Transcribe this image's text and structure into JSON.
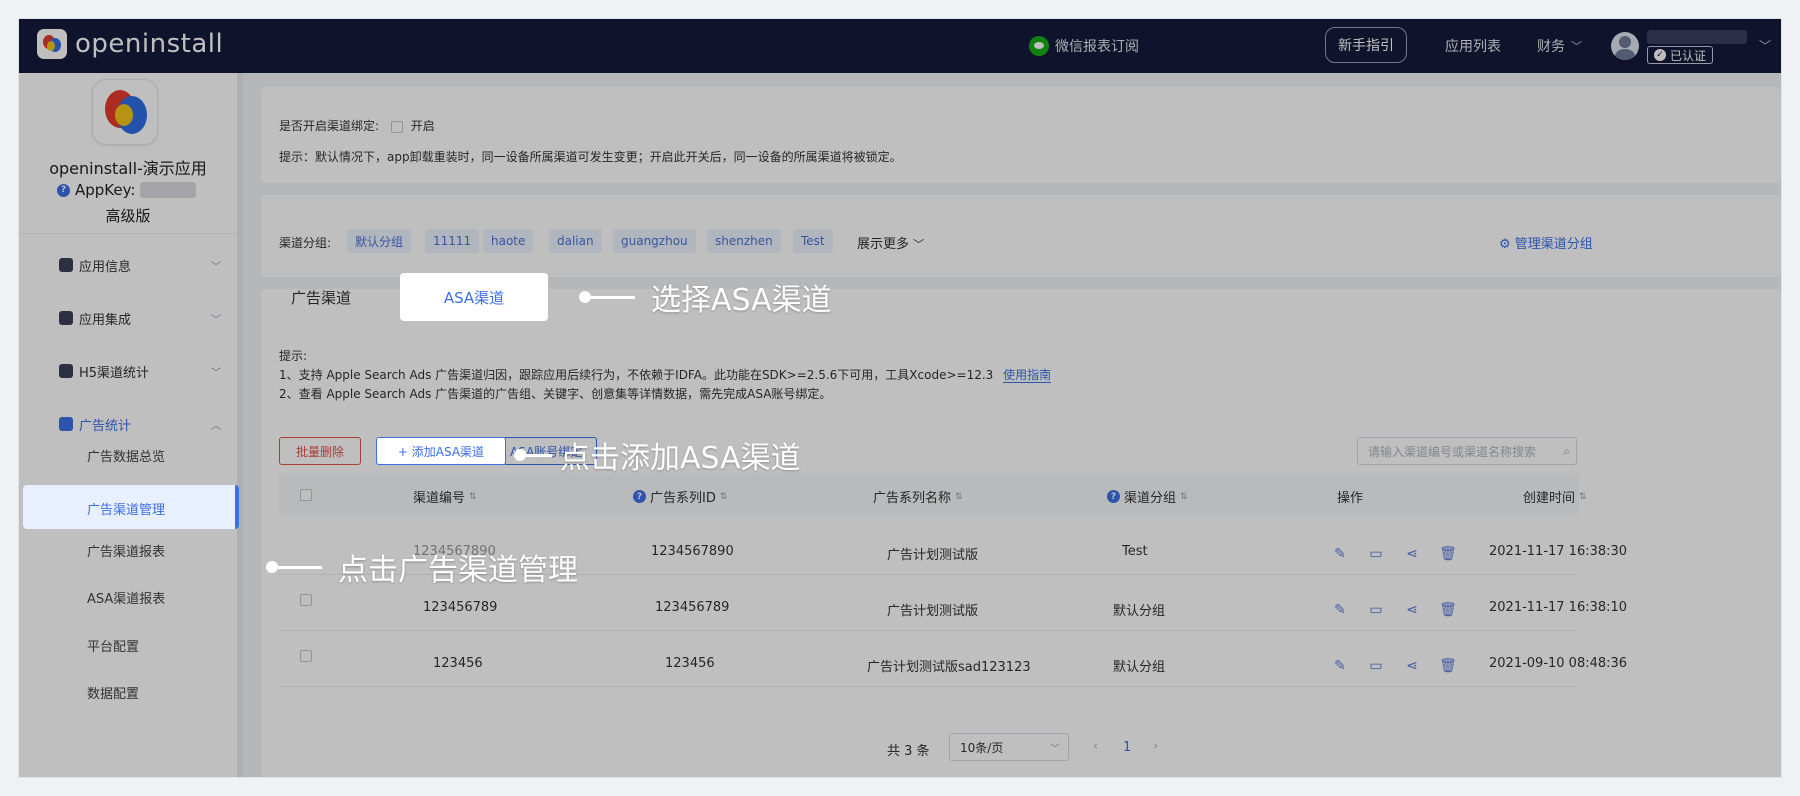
{
  "header": {
    "logo_text": "openinstall",
    "wechat_label": "微信报表订阅",
    "guide_label": "新手指引",
    "app_list_label": "应用列表",
    "finance_label": "财务",
    "verified_label": "已认证"
  },
  "sidebar": {
    "app_name": "openinstall-演示应用",
    "appkey_label": "AppKey:",
    "edition": "高级版",
    "menus": [
      {
        "label": "应用信息"
      },
      {
        "label": "应用集成"
      },
      {
        "label": "H5渠道统计"
      },
      {
        "label": "广告统计"
      }
    ],
    "submenus": [
      {
        "label": "广告数据总览"
      },
      {
        "label": "广告渠道管理"
      },
      {
        "label": "广告渠道报表"
      },
      {
        "label": "ASA渠道报表"
      },
      {
        "label": "平台配置"
      },
      {
        "label": "数据配置"
      }
    ]
  },
  "binding": {
    "label": "是否开启渠道绑定:",
    "option": "开启",
    "hint": "提示：默认情况下，app卸载重装时，同一设备所属渠道可发生变更；开启此开关后，同一设备的所属渠道将被锁定。"
  },
  "groups": {
    "label": "渠道分组:",
    "tags": [
      "默认分组",
      "11111",
      "haote",
      "dalian",
      "guangzhou",
      "shenzhen",
      "Test"
    ],
    "more_label": "展示更多",
    "manage_label": "管理渠道分组"
  },
  "tabs": [
    {
      "label": "广告渠道"
    },
    {
      "label": "ASA渠道"
    }
  ],
  "tips": {
    "title": "提示:",
    "line1": "1、支持 Apple Search Ads 广告渠道归因，跟踪应用后续行为，不依赖于IDFA。此功能在SDK>=2.5.6下可用，工具Xcode>=12.3",
    "line1_link": "使用指南",
    "line2": "2、查看 Apple Search Ads 广告渠道的广告组、关键字、创意集等详情数据，需先完成ASA账号绑定。"
  },
  "toolbar": {
    "batch_delete": "批量删除",
    "add_asa": "+ 添加ASA渠道",
    "bind_asa": "ASA账号绑定",
    "search_placeholder": "请输入渠道编号或渠道名称搜索"
  },
  "table": {
    "headers": [
      "渠道编号",
      "广告系列ID",
      "广告系列名称",
      "渠道分组",
      "操作",
      "创建时间"
    ],
    "rows": [
      {
        "code": "1234567890",
        "campaign_id": "1234567890",
        "campaign_name": "广告计划测试版",
        "group": "Test",
        "created": "2021-11-17 16:38:30"
      },
      {
        "code": "123456789",
        "campaign_id": "123456789",
        "campaign_name": "广告计划测试版",
        "group": "默认分组",
        "created": "2021-11-17 16:38:10"
      },
      {
        "code": "123456",
        "campaign_id": "123456",
        "campaign_name": "广告计划测试版sad123123",
        "group": "默认分组",
        "created": "2021-09-10 08:48:36"
      }
    ]
  },
  "pagination": {
    "total": "共 3 条",
    "page_size": "10条/页",
    "current": "1"
  },
  "annotations": {
    "select_asa": "选择ASA渠道",
    "click_add": "点击添加ASA渠道",
    "click_manage": "点击广告渠道管理"
  },
  "colors": {
    "header_bg": "#141a3a",
    "accent": "#3d6fe6",
    "danger": "#e0524b"
  }
}
